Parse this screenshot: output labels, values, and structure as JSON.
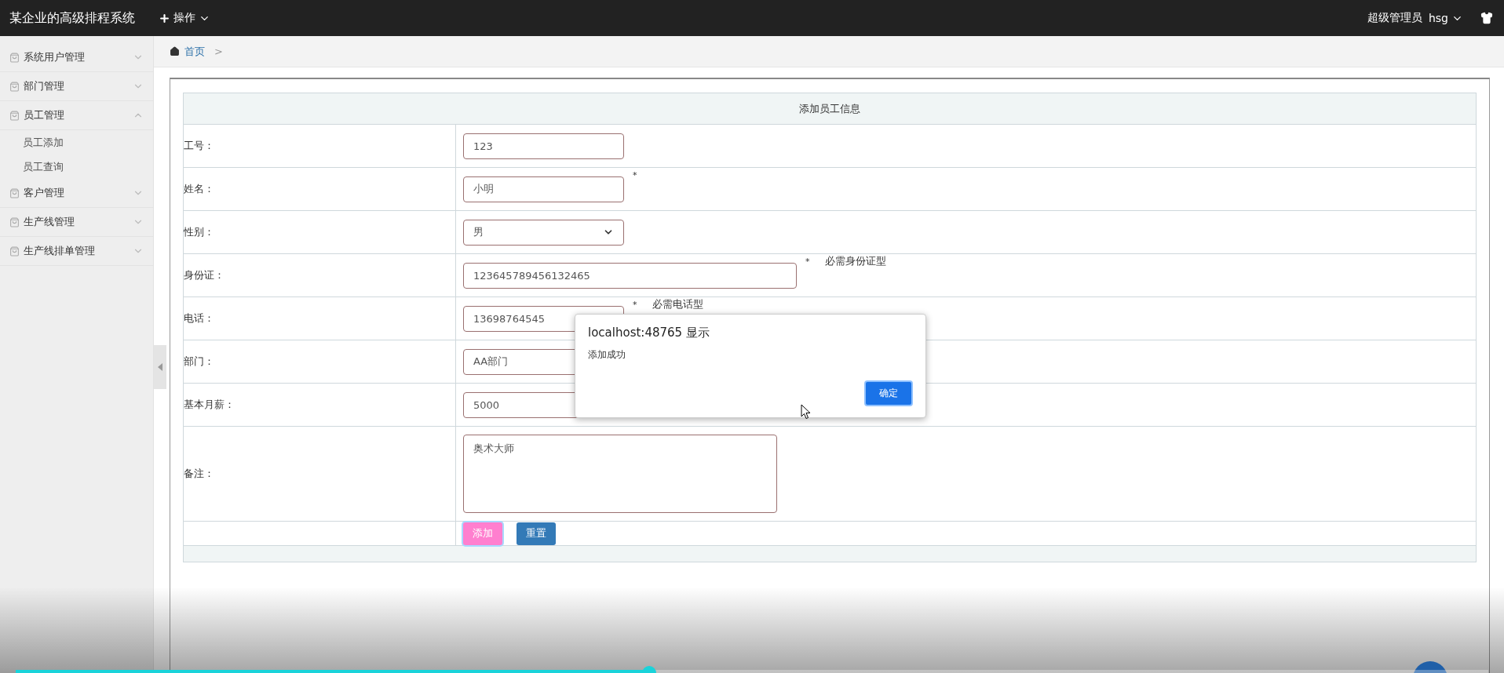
{
  "header": {
    "title": "某企业的高级排程系统",
    "menu": "操作",
    "role": "超级管理员",
    "user": "hsg"
  },
  "sidebar": {
    "items": [
      {
        "label": "系统用户管理",
        "expanded": false
      },
      {
        "label": "部门管理",
        "expanded": false
      },
      {
        "label": "员工管理",
        "expanded": true,
        "children": [
          {
            "label": "员工添加"
          },
          {
            "label": "员工查询"
          }
        ]
      },
      {
        "label": "客户管理",
        "expanded": false
      },
      {
        "label": "生产线管理",
        "expanded": false
      },
      {
        "label": "生产线排单管理",
        "expanded": false
      }
    ]
  },
  "breadcrumb": {
    "items": [
      "首页"
    ],
    "separator": ">"
  },
  "form": {
    "title": "添加员工信息",
    "rows": [
      {
        "kind": "input",
        "label": "工号：",
        "value": "123"
      },
      {
        "kind": "input",
        "label": "姓名：",
        "value": "小明",
        "mark": "*"
      },
      {
        "kind": "select",
        "label": "性别：",
        "value": "男"
      },
      {
        "kind": "input-wide",
        "label": "身份证：",
        "value": "123645789456132465",
        "mark": "*",
        "hint": "必需身份证型"
      },
      {
        "kind": "input",
        "label": "电话：",
        "value": "13698764545",
        "mark": "*",
        "hint": "必需电话型"
      },
      {
        "kind": "input",
        "label": "部门：",
        "value": "AA部门"
      },
      {
        "kind": "input",
        "label": "基本月薪：",
        "value": "5000"
      },
      {
        "kind": "textarea",
        "label": "备注：",
        "value": "奥术大师"
      }
    ],
    "buttons": [
      {
        "label": "添加",
        "kind": "primary",
        "focused": true
      },
      {
        "label": "重置",
        "kind": "secondary",
        "focused": false
      }
    ]
  },
  "dialog": {
    "title": "localhost:48765 显示",
    "message": "添加成功",
    "button": "确定"
  },
  "player": {
    "level": 0.43
  }
}
